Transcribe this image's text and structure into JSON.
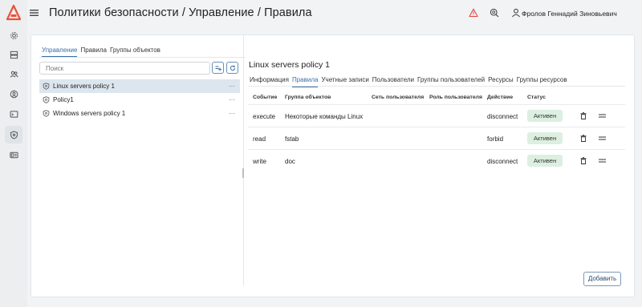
{
  "header": {
    "title": "Политики безопасности / Управление / Правила",
    "user_name": "Фролов Геннадий Зиновьевич"
  },
  "sidebar": {
    "items": [
      {
        "icon": "gear-icon"
      },
      {
        "icon": "server-icon"
      },
      {
        "icon": "users-icon"
      },
      {
        "icon": "user-icon"
      },
      {
        "icon": "terminal-icon"
      },
      {
        "icon": "shield-icon",
        "active": true
      },
      {
        "icon": "id-card-icon"
      }
    ]
  },
  "left_pane": {
    "tabs": [
      "Управление",
      "Правила",
      "Группы объектов"
    ],
    "active_tab": 0,
    "search_placeholder": "Поиск",
    "policies": [
      {
        "name": "Linux servers policy 1",
        "selected": true
      },
      {
        "name": "Policy1",
        "selected": false
      },
      {
        "name": "Windows servers policy 1",
        "selected": false
      }
    ],
    "row_menu": "···"
  },
  "right_pane": {
    "title": "Linux servers policy 1",
    "tabs": [
      "Информация",
      "Правила",
      "Учетные записи",
      "Пользователи",
      "Группы пользователей",
      "Ресурсы",
      "Группы ресурсов"
    ],
    "active_tab": 1,
    "columns": [
      "Событие",
      "Группа объектов",
      "Сеть пользователя",
      "Роль пользователя",
      "Действие",
      "Статус"
    ],
    "rows": [
      {
        "event": "execute",
        "group": "Некоторые команды Linux",
        "network": "",
        "role": "",
        "action": "disconnect",
        "status": "Активен"
      },
      {
        "event": "read",
        "group": "fstab",
        "network": "",
        "role": "",
        "action": "forbid",
        "status": "Активен"
      },
      {
        "event": "write",
        "group": "doc",
        "network": "",
        "role": "",
        "action": "disconnect",
        "status": "Активен"
      }
    ],
    "add_label": "Добавить"
  },
  "colors": {
    "accent": "#3a6fa8",
    "status_active_bg": "#dcefe0",
    "warning": "#e0463c",
    "logo": "#e8523a"
  }
}
